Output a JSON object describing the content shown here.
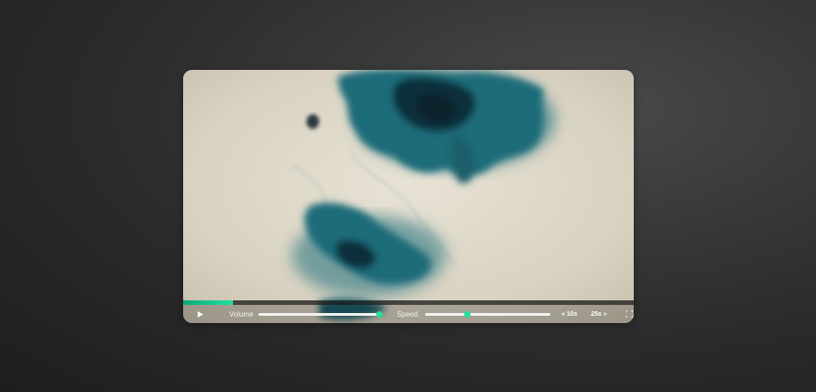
{
  "colors": {
    "accent": "#22e0a0",
    "progress_track": "#1a1a1a",
    "ink_dark": "#0f2f3a",
    "ink_mid": "#1c6a78",
    "paper": "#dcd6c7"
  },
  "player": {
    "progress": 0.11,
    "controls": {
      "play_icon": "play-icon",
      "volume_label": "Volume",
      "volume_level": 0.99,
      "speed_label": "Speed",
      "speed_level": 0.34,
      "skip_back_label": "« 10s",
      "skip_forward_label": "25s »",
      "fullscreen_icon": "fullscreen-icon"
    }
  }
}
